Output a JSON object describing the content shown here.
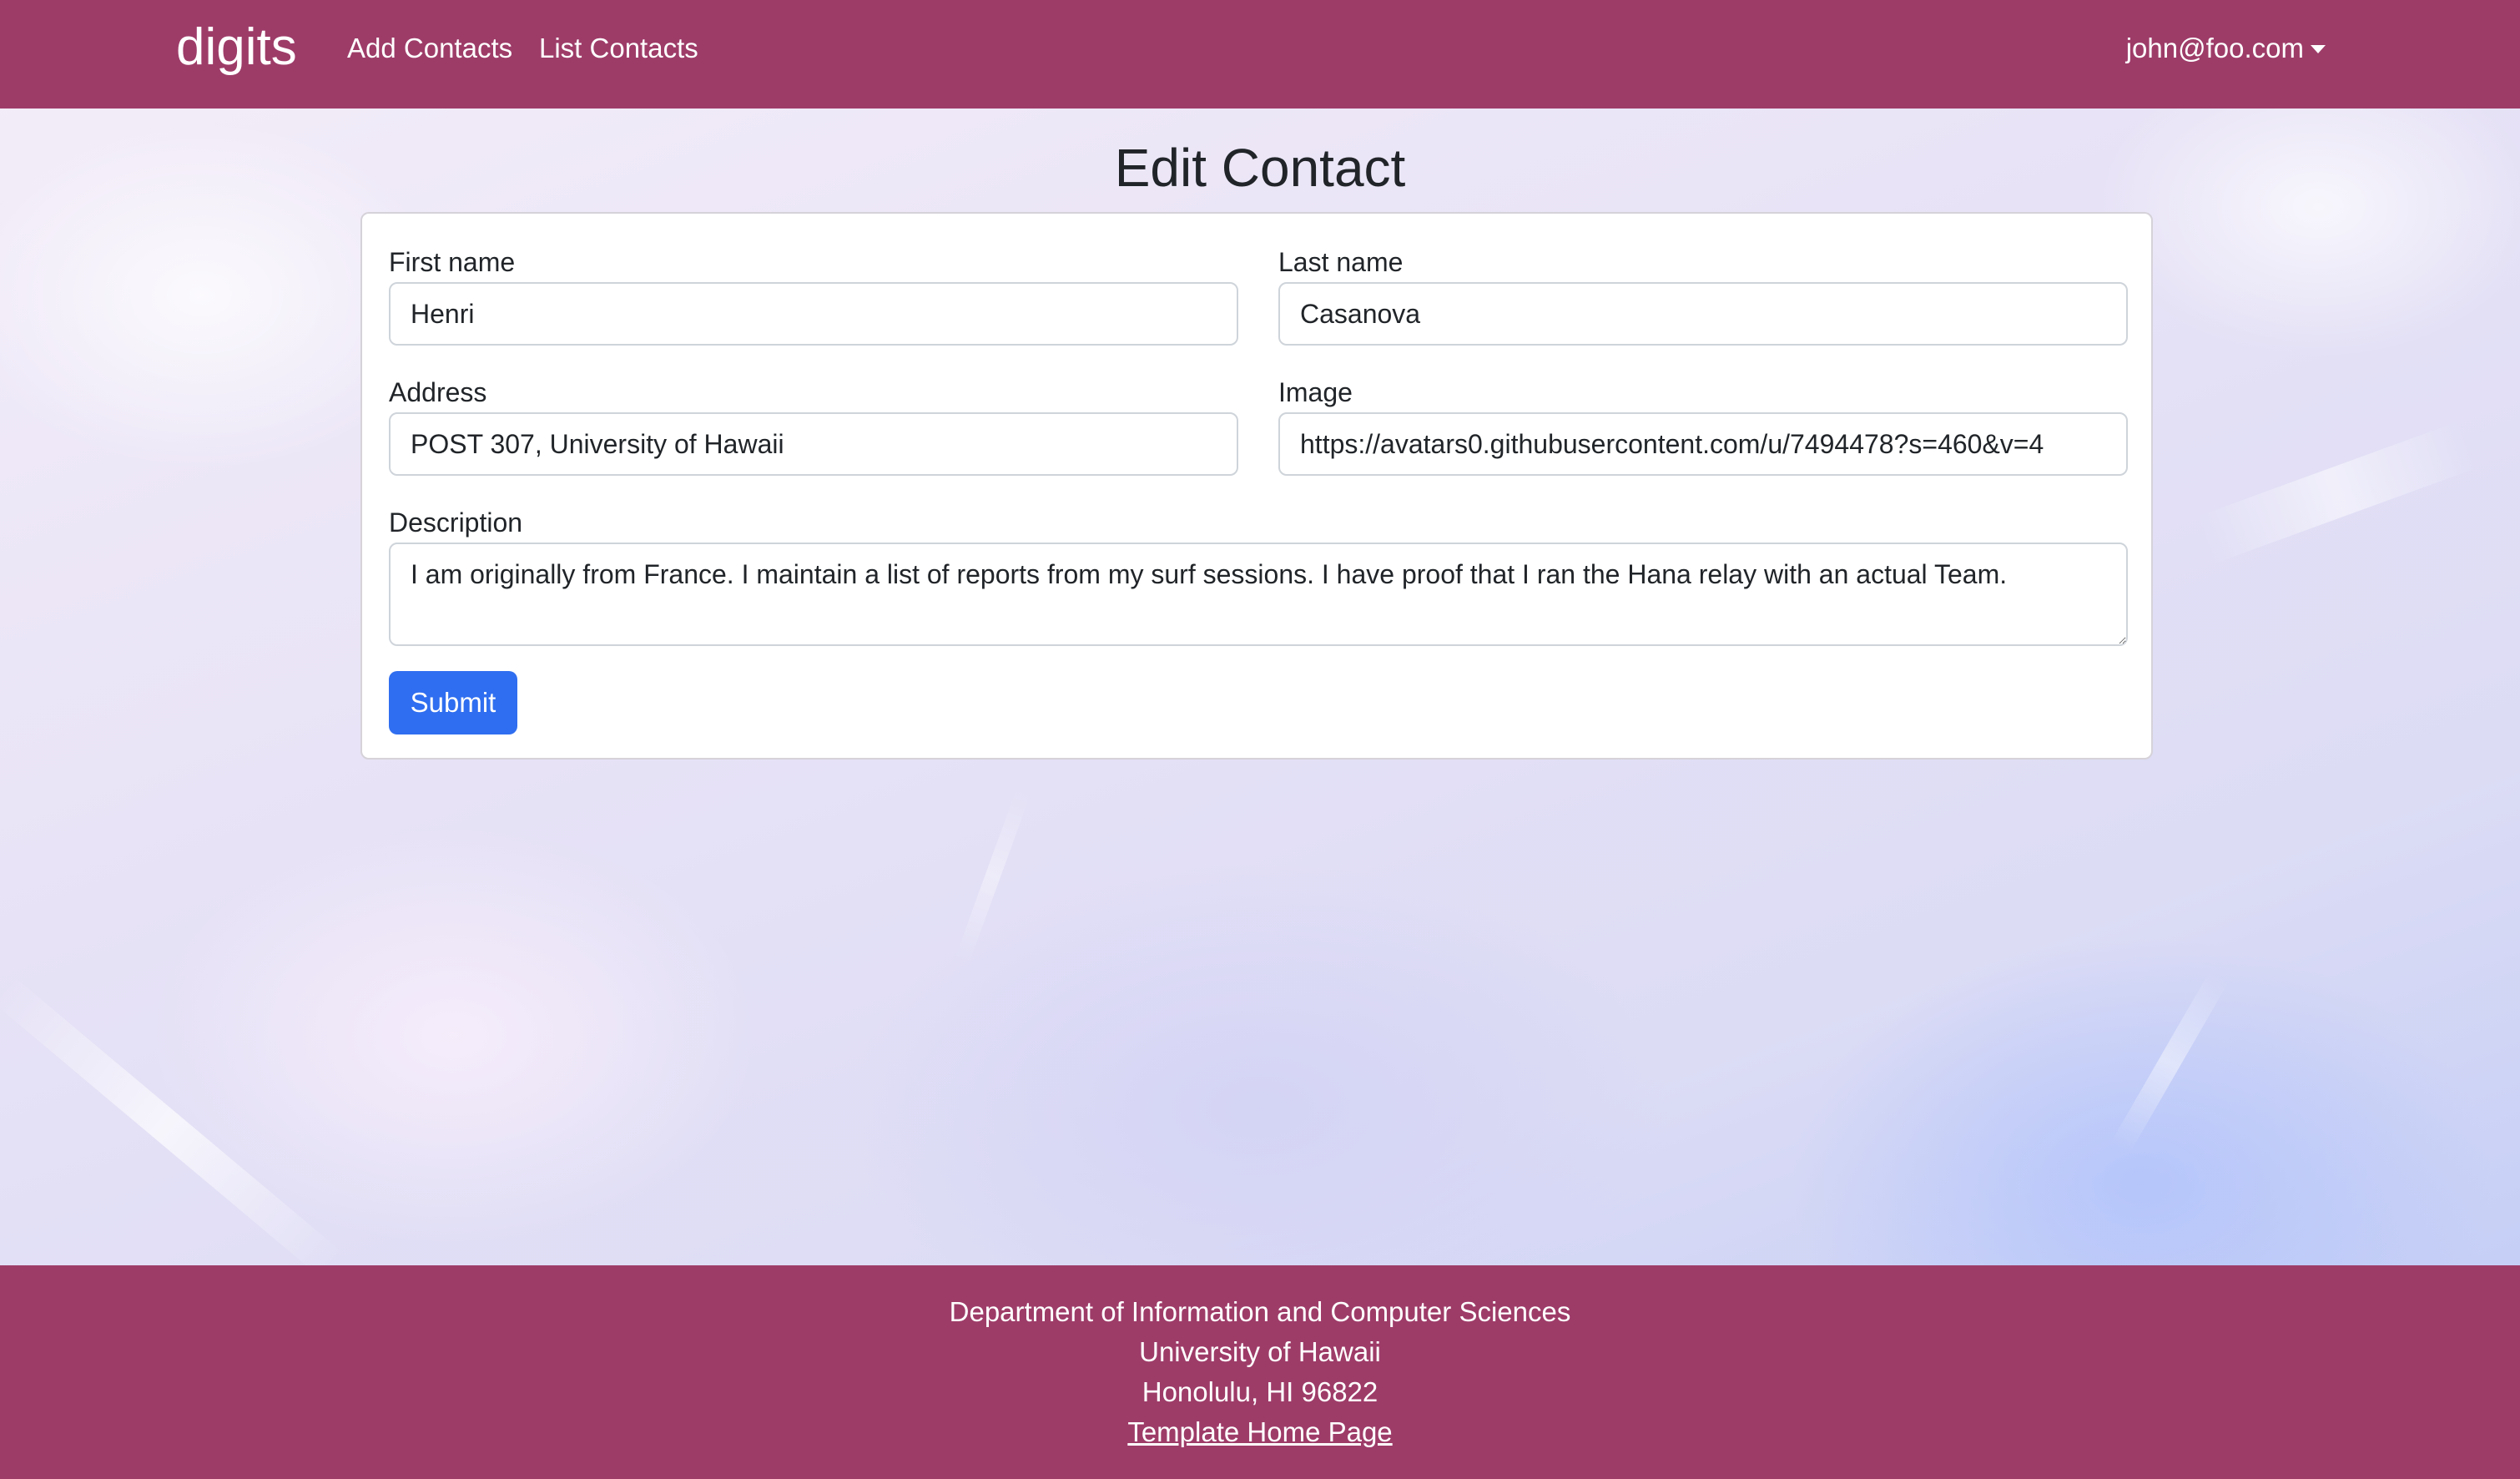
{
  "navbar": {
    "brand": "digits",
    "links": [
      {
        "label": "Add Contacts"
      },
      {
        "label": "List Contacts"
      }
    ],
    "user_menu": "john@foo.com"
  },
  "page": {
    "title": "Edit Contact"
  },
  "form": {
    "first_name": {
      "label": "First name",
      "value": "Henri"
    },
    "last_name": {
      "label": "Last name",
      "value": "Casanova"
    },
    "address": {
      "label": "Address",
      "value": "POST 307, University of Hawaii"
    },
    "image": {
      "label": "Image",
      "value": "https://avatars0.githubusercontent.com/u/7494478?s=460&v=4"
    },
    "description": {
      "label": "Description",
      "value": "I am originally from France. I maintain a list of reports from my surf sessions. I have proof that I ran the Hana relay with an actual Team."
    },
    "submit_label": "Submit"
  },
  "footer": {
    "line1": "Department of Information and Computer Sciences",
    "line2": "University of Hawaii",
    "line3": "Honolulu, HI 96822",
    "link": "Template Home Page"
  },
  "colors": {
    "navbar_bg": "#9e3c68",
    "submit_bg": "#2f6ef0"
  }
}
